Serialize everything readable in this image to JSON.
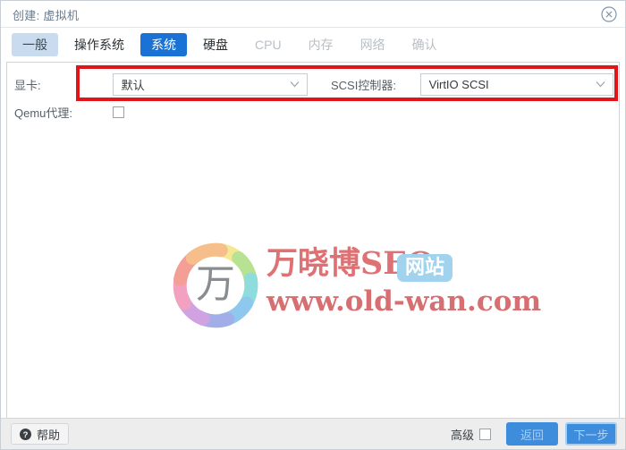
{
  "window": {
    "title": "创建: 虚拟机",
    "close_icon": "close-circle-icon"
  },
  "tabs": [
    {
      "label": "一般",
      "state": "visited"
    },
    {
      "label": "操作系统",
      "state": "normal"
    },
    {
      "label": "系统",
      "state": "active"
    },
    {
      "label": "硬盘",
      "state": "normal"
    },
    {
      "label": "CPU",
      "state": "disabled"
    },
    {
      "label": "内存",
      "state": "disabled"
    },
    {
      "label": "网络",
      "state": "disabled"
    },
    {
      "label": "确认",
      "state": "disabled"
    }
  ],
  "form": {
    "graphics": {
      "label": "显卡:",
      "value": "默认",
      "chevron_icon": "chevron-down-icon"
    },
    "scsi": {
      "label": "SCSI控制器:",
      "value": "VirtIO SCSI",
      "chevron_icon": "chevron-down-icon"
    },
    "qemu_agent": {
      "label": "Qemu代理:",
      "checked": false
    },
    "annotation_color": "#e1141a"
  },
  "watermark": {
    "logo_char": "万",
    "title": "万晓博SEO",
    "badge": "网站",
    "url": "www.old-wan.com",
    "title_color": "#d03b3f",
    "badge_color": "#7dc3ea",
    "logo_colors": [
      "#f2e06a",
      "#9ed86a",
      "#63cfcf",
      "#63b4e8",
      "#7d8fe0",
      "#c07fd8",
      "#ee7fa8",
      "#ef7b6e",
      "#f3a65e"
    ]
  },
  "footer": {
    "help_label": "帮助",
    "help_icon": "question-mark-icon",
    "advanced_label": "高级",
    "advanced_checked": false,
    "back_label": "返回",
    "next_label": "下一步",
    "accent_color": "#3e8ddd"
  }
}
